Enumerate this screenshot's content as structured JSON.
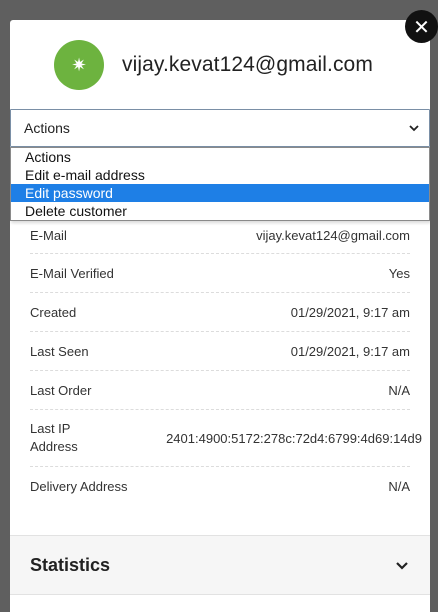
{
  "modal": {
    "email": "vijay.kevat124@gmail.com",
    "avatar_icon": "sparkle-icon",
    "close_icon": "close-icon"
  },
  "actions": {
    "selected": "Actions",
    "options": [
      "Actions",
      "Edit e-mail address",
      "Edit password",
      "Delete customer"
    ],
    "highlighted_index": 2
  },
  "details": [
    {
      "label": "E-Mail",
      "value": "vijay.kevat124@gmail.com"
    },
    {
      "label": "E-Mail Verified",
      "value": "Yes"
    },
    {
      "label": "Created",
      "value": "01/29/2021, 9:17 am"
    },
    {
      "label": "Last Seen",
      "value": "01/29/2021, 9:17 am"
    },
    {
      "label": "Last Order",
      "value": "N/A"
    },
    {
      "label": "Last IP Address",
      "value": "2401:4900:5172:278c:72d4:6799:4d69:14d9"
    },
    {
      "label": "Delivery Address",
      "value": "N/A"
    }
  ],
  "statistics": {
    "title": "Statistics"
  },
  "colors": {
    "avatar": "#6db33f",
    "highlight": "#1e7fe6",
    "overlay": "#5f5f5f"
  }
}
